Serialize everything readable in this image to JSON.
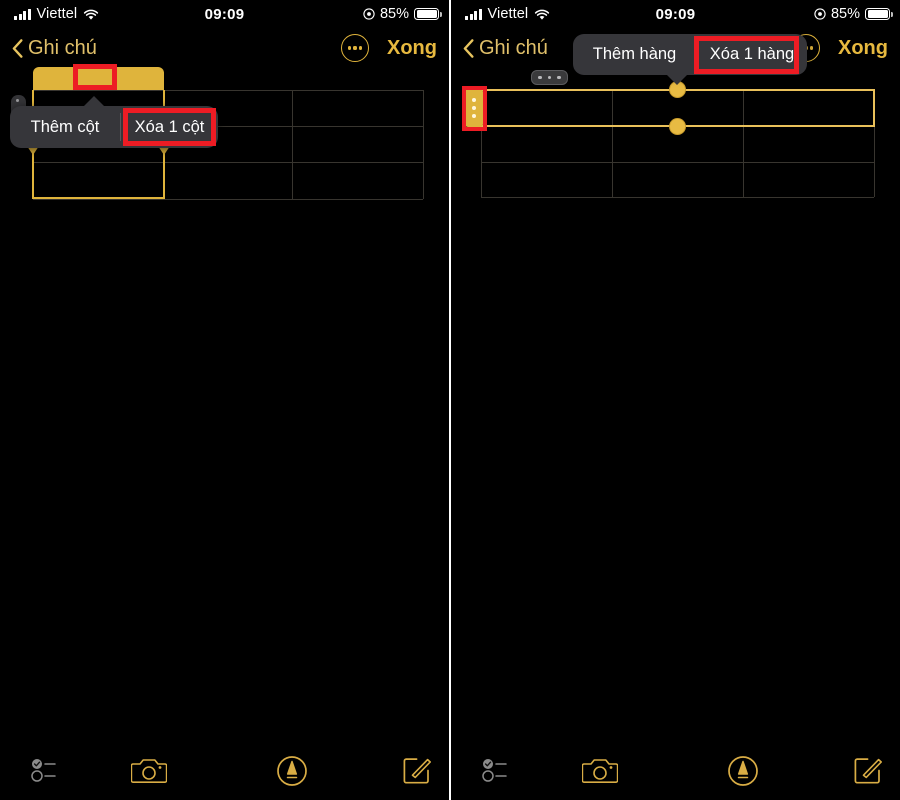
{
  "screens": [
    {
      "id": "left",
      "status_bar": {
        "carrier": "Viettel",
        "signal_icon": "signal-bars-icon",
        "wifi_icon": "wifi-icon",
        "time": "09:09",
        "location_icon": "location-services-icon",
        "battery_percent": "85%",
        "battery_icon": "battery-icon"
      },
      "nav_bar": {
        "back_icon": "chevron-left-icon",
        "back_label": "Ghi chú",
        "more_icon": "more-ellipsis-icon",
        "done_label": "Xong"
      },
      "table": {
        "columns": 3,
        "rows": 3,
        "selected_kind": "column",
        "selected_index": 0,
        "column_handle_icon": "column-ellipsis-handle-icon",
        "cells": [
          [
            "",
            "",
            ""
          ],
          [
            "",
            "",
            ""
          ],
          [
            "",
            "",
            ""
          ]
        ]
      },
      "context_menu": {
        "items": [
          {
            "label": "Thêm cột",
            "name": "add-column-menu-item",
            "highlighted": false
          },
          {
            "label": "Xóa 1 cột",
            "name": "delete-column-menu-item",
            "highlighted": true
          }
        ]
      },
      "annotations": [
        {
          "name": "column-handle-highlight",
          "target": "column-ellipsis-handle-icon"
        },
        {
          "name": "delete-column-highlight",
          "target": "delete-column-menu-item"
        }
      ],
      "toolbar": {
        "items": [
          {
            "label": "",
            "icon": "checklist-icon",
            "name": "checklist-button"
          },
          {
            "label": "",
            "icon": "camera-icon",
            "name": "camera-button"
          },
          {
            "label": "",
            "icon": "markup-pen-icon",
            "name": "markup-button"
          },
          {
            "label": "",
            "icon": "compose-icon",
            "name": "compose-button"
          }
        ]
      }
    },
    {
      "id": "right",
      "status_bar": {
        "carrier": "Viettel",
        "signal_icon": "signal-bars-icon",
        "wifi_icon": "wifi-icon",
        "time": "09:09",
        "location_icon": "location-services-icon",
        "battery_percent": "85%",
        "battery_icon": "battery-icon"
      },
      "nav_bar": {
        "back_icon": "chevron-left-icon",
        "back_label": "Ghi chú",
        "more_icon": "more-ellipsis-icon",
        "done_label": "Xong"
      },
      "table": {
        "columns": 3,
        "rows": 3,
        "selected_kind": "row",
        "selected_index": 0,
        "row_handle_icon": "row-ellipsis-handle-icon",
        "column_handle_icon": "column-ellipsis-handle-icon",
        "cells": [
          [
            "",
            "",
            ""
          ],
          [
            "",
            "",
            ""
          ],
          [
            "",
            "",
            ""
          ]
        ]
      },
      "context_menu": {
        "items": [
          {
            "label": "Thêm hàng",
            "name": "add-row-menu-item",
            "highlighted": false
          },
          {
            "label": "Xóa 1 hàng",
            "name": "delete-row-menu-item",
            "highlighted": true
          }
        ]
      },
      "annotations": [
        {
          "name": "row-handle-highlight",
          "target": "row-ellipsis-handle-icon"
        },
        {
          "name": "delete-row-highlight",
          "target": "delete-row-menu-item"
        }
      ],
      "toolbar": {
        "items": [
          {
            "label": "",
            "icon": "checklist-icon",
            "name": "checklist-button"
          },
          {
            "label": "",
            "icon": "camera-icon",
            "name": "camera-button"
          },
          {
            "label": "",
            "icon": "markup-pen-icon",
            "name": "markup-button"
          },
          {
            "label": "",
            "icon": "compose-icon",
            "name": "compose-button"
          }
        ]
      }
    }
  ],
  "colors": {
    "background": "#000000",
    "accent_yellow": "#dfb43c",
    "nav_label": "#e0c06a",
    "done_label": "#e7b93f",
    "annotation_red": "#ed1c24",
    "menu_background": "#36363a",
    "grid_line": "#38352f",
    "divider": "#ffffff"
  }
}
